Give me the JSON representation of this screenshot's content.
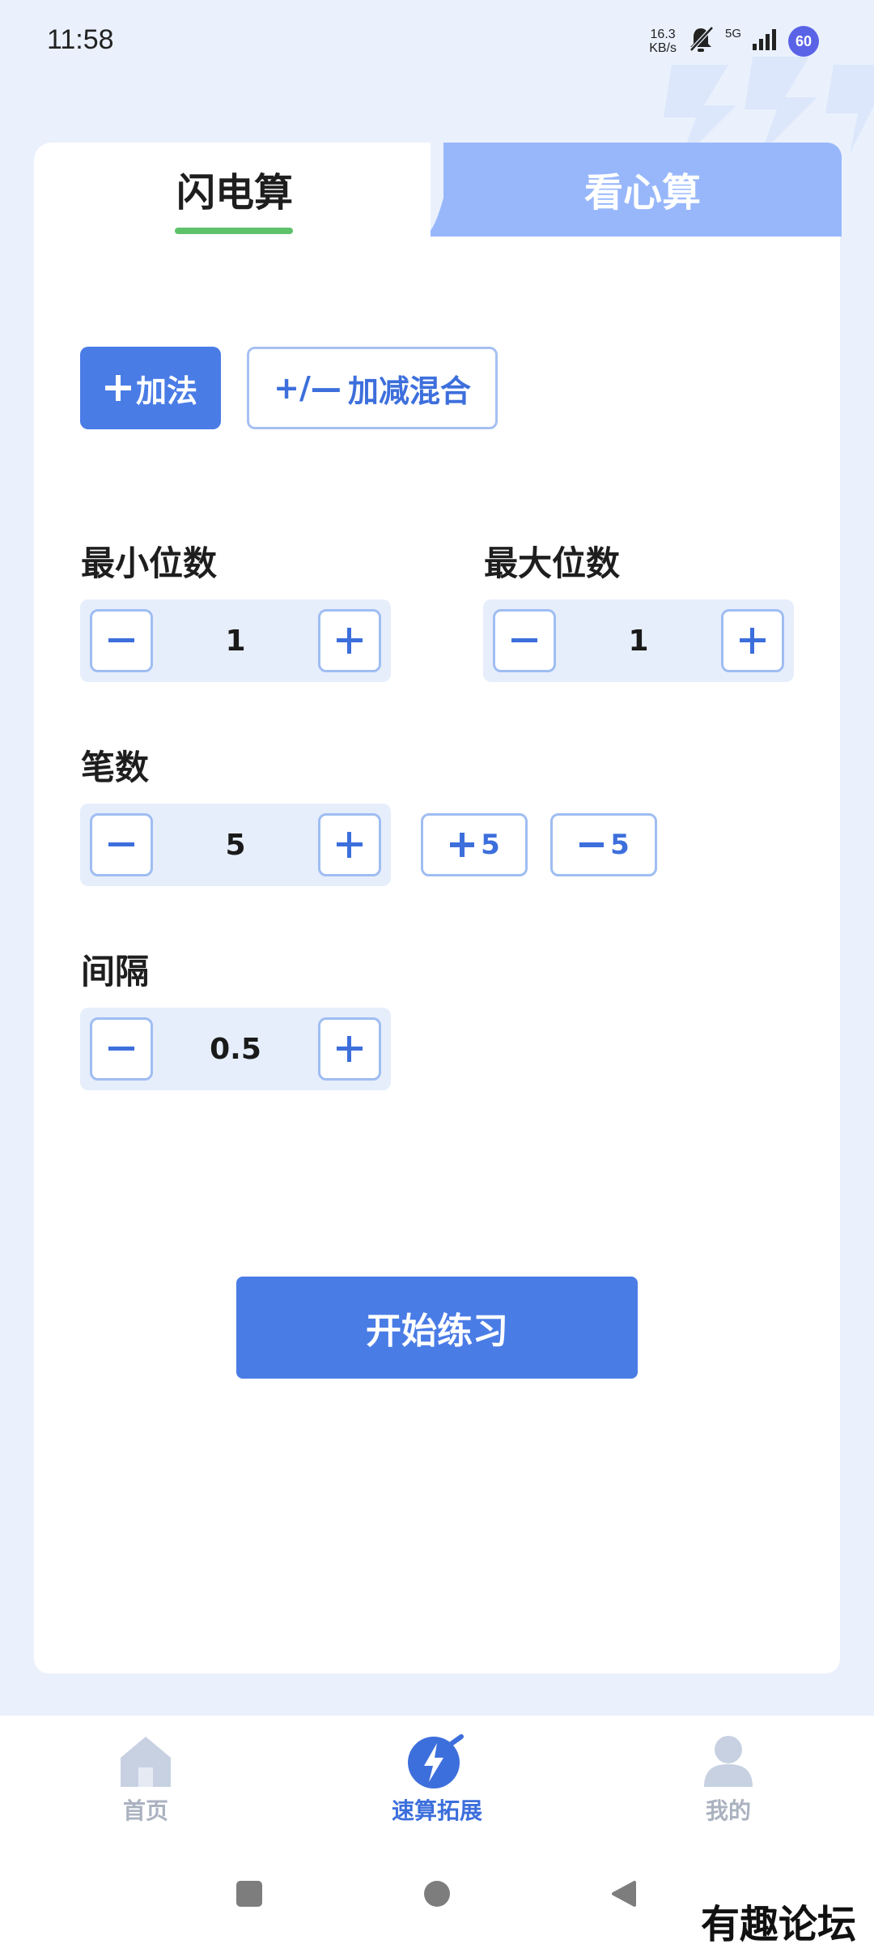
{
  "status_bar": {
    "time": "11:58",
    "net_speed_value": "16.3",
    "net_speed_unit": "KB/s",
    "network_type": "5G",
    "battery": "60"
  },
  "tabs": {
    "active": "闪电算",
    "inactive": "看心算"
  },
  "modes": {
    "add_label": "加法",
    "mix_label": "加减混合",
    "mix_symbol": "+/—",
    "selected": "加法"
  },
  "settings": {
    "min_digits": {
      "label": "最小位数",
      "value": "1"
    },
    "max_digits": {
      "label": "最大位数",
      "value": "1"
    },
    "count": {
      "label": "笔数",
      "value": "5",
      "plus_quick": "5",
      "minus_quick": "5"
    },
    "interval": {
      "label": "间隔",
      "value": "0.5"
    }
  },
  "start_button": "开始练习",
  "bottom_nav": {
    "items": [
      {
        "label": "首页",
        "icon": "home-icon",
        "active": false
      },
      {
        "label": "速算拓展",
        "icon": "lightning-icon",
        "active": true
      },
      {
        "label": "我的",
        "icon": "profile-icon",
        "active": false
      }
    ],
    "active_color": "#3d6fdc",
    "inactive_color": "#aab2c0"
  },
  "watermark": "有趣论坛",
  "colors": {
    "primary": "#4a7ce6",
    "tab_inactive": "#98b7fb",
    "underline": "#5ec26a",
    "background": "#eaf1fd"
  }
}
